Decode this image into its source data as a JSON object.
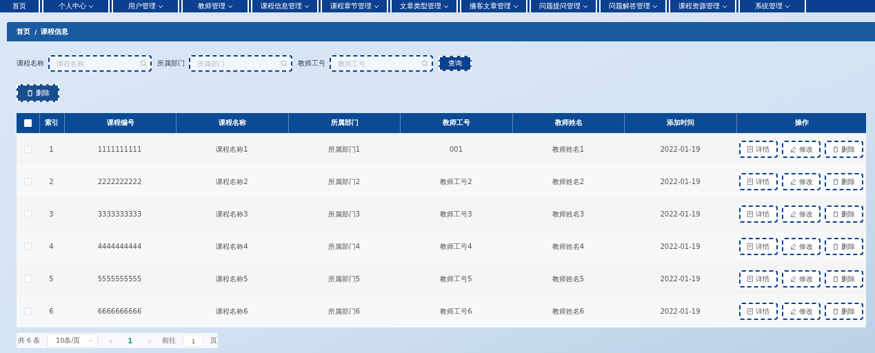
{
  "nav": [
    {
      "label": "首页",
      "has_menu": false
    },
    {
      "label": "个人中心",
      "has_menu": true
    },
    {
      "label": "用户管理",
      "has_menu": true
    },
    {
      "label": "教师管理",
      "has_menu": true
    },
    {
      "label": "课程信息管理",
      "has_menu": true
    },
    {
      "label": "课程章节管理",
      "has_menu": true
    },
    {
      "label": "文章类型管理",
      "has_menu": true
    },
    {
      "label": "播客文章管理",
      "has_menu": true
    },
    {
      "label": "问题提问管理",
      "has_menu": true
    },
    {
      "label": "问题解答管理",
      "has_menu": true
    },
    {
      "label": "课程资源管理",
      "has_menu": true
    },
    {
      "label": "系统管理",
      "has_menu": true
    }
  ],
  "breadcrumb": [
    "首页",
    "/",
    "课程信息"
  ],
  "search": [
    {
      "label": "课程名称",
      "placeholder": "课程名称"
    },
    {
      "label": "所属部门",
      "placeholder": "所属部门"
    },
    {
      "label": "教师工号",
      "placeholder": "教师工号"
    }
  ],
  "search_button": "查询",
  "delete_button": "删除",
  "table": {
    "select_all_checked": false,
    "columns": [
      "索引",
      "课程编号",
      "课程名称",
      "所属部门",
      "教师工号",
      "教师姓名",
      "添加时间",
      "操作"
    ],
    "rows": [
      {
        "checked": false,
        "cells": [
          "1",
          "1111111111",
          "课程名称1",
          "所属部门1",
          "001",
          "教师姓名1",
          "2022-01-19"
        ],
        "actions": [
          "详情",
          "修改",
          "删除"
        ]
      },
      {
        "checked": false,
        "cells": [
          "2",
          "2222222222",
          "课程名称2",
          "所属部门2",
          "教师工号2",
          "教师姓名2",
          "2022-01-19"
        ],
        "actions": [
          "详情",
          "修改",
          "删除"
        ]
      },
      {
        "checked": false,
        "cells": [
          "3",
          "3333333333",
          "课程名称3",
          "所属部门3",
          "教师工号3",
          "教师姓名3",
          "2022-01-19"
        ],
        "actions": [
          "详情",
          "修改",
          "删除"
        ]
      },
      {
        "checked": false,
        "cells": [
          "4",
          "4444444444",
          "课程名称4",
          "所属部门4",
          "教师工号4",
          "教师姓名4",
          "2022-01-19"
        ],
        "actions": [
          "详情",
          "修改",
          "删除"
        ]
      },
      {
        "checked": false,
        "cells": [
          "5",
          "5555555555",
          "课程名称5",
          "所属部门5",
          "教师工号5",
          "教师姓名5",
          "2022-01-19"
        ],
        "actions": [
          "详情",
          "修改",
          "删除"
        ]
      },
      {
        "checked": false,
        "cells": [
          "6",
          "6666666666",
          "课程名称6",
          "所属部门6",
          "教师工号6",
          "教师姓名6",
          "2022-01-19"
        ],
        "actions": [
          "详情",
          "修改",
          "删除"
        ]
      }
    ]
  },
  "pagination": {
    "total": "共 6 条",
    "page_size": "10条/页",
    "prev": "‹",
    "pages": [
      {
        "label": "1",
        "selected": true
      }
    ],
    "next": "›",
    "goto_label": "前往",
    "goto_value": "1",
    "goto_suffix": "页"
  }
}
